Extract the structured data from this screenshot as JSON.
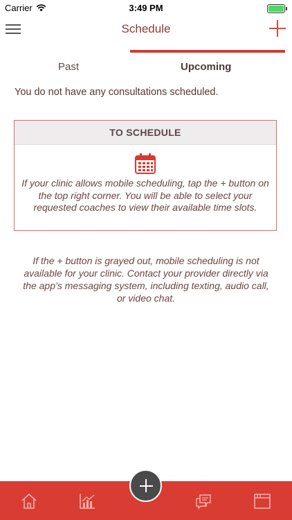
{
  "status_bar": {
    "carrier": "Carrier",
    "time": "3:49 PM"
  },
  "header": {
    "title": "Schedule",
    "menu_icon": "hamburger-menu-icon",
    "add_icon": "plus-icon"
  },
  "tabs": [
    {
      "label": "Past",
      "active": false
    },
    {
      "label": "Upcoming",
      "active": true
    }
  ],
  "empty_message": "You do not have any consultations scheduled.",
  "schedule_card": {
    "title": "TO SCHEDULE",
    "icon": "calendar-icon",
    "body": "If your clinic allows mobile scheduling, tap the + button on the top right corner. You will be able to select your requested coaches to view their available time slots."
  },
  "note": "If the + button is grayed out, mobile scheduling is not available for your clinic. Contact your provider directly via the app’s messaging system, including texting, audio call, or video chat.",
  "tab_bar": {
    "items": [
      "home-icon",
      "chart-icon",
      "add-icon",
      "chat-icon",
      "browser-window-icon"
    ]
  },
  "colors": {
    "accent": "#d83c33",
    "fab": "#4a4a4a",
    "battery": "#4cd964"
  }
}
